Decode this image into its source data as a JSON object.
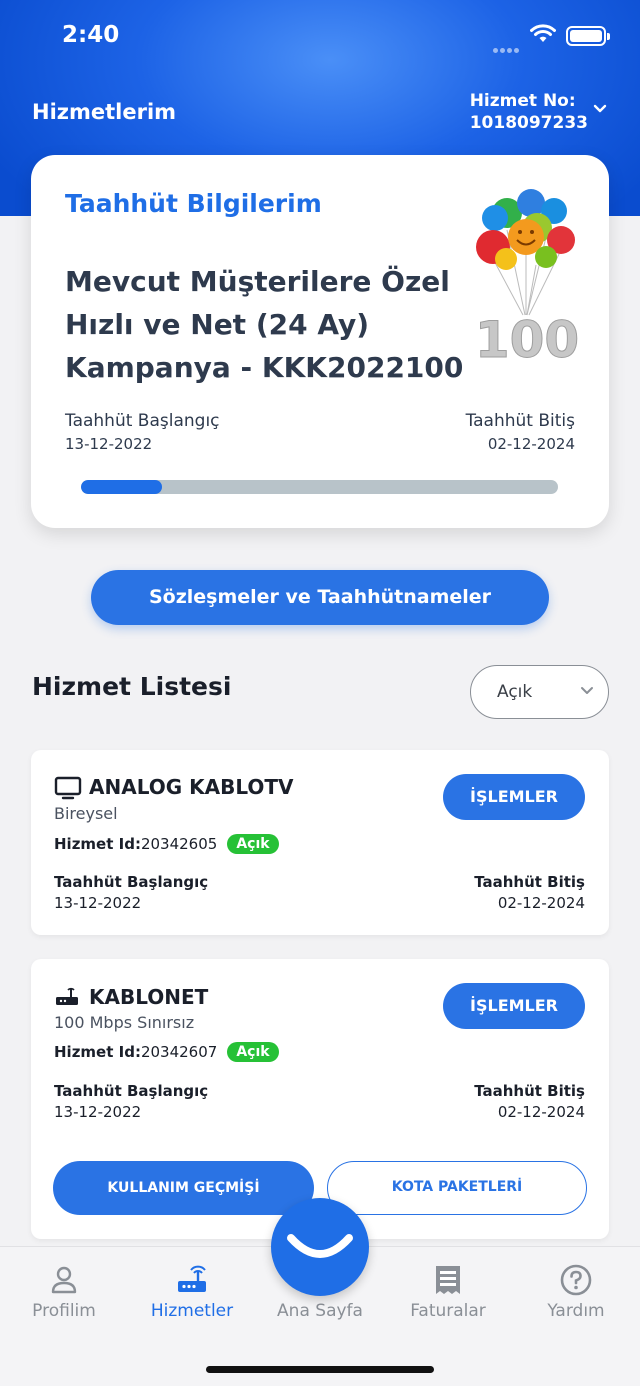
{
  "status_bar": {
    "time": "2:40"
  },
  "header": {
    "title": "Hizmetlerim",
    "service_no_label": "Hizmet No:",
    "service_no_value": "1018097233"
  },
  "commitment_card": {
    "title": "Taahhüt Bilgilerim",
    "campaign_name": "Mevcut Müşterilere Özel Hızlı ve Net (24 Ay) Kampanya - KKK2022100",
    "start_label": "Taahhüt Başlangıç",
    "start_date": "13-12-2022",
    "end_label": "Taahhüt Bitiş",
    "end_date": "02-12-2024",
    "progress_fraction": 0.17,
    "badge_number": "100"
  },
  "contracts_button_label": "Sözleşmeler ve Taahhütnameler",
  "service_list": {
    "title": "Hizmet Listesi",
    "filter_selected": "Açık",
    "items": [
      {
        "icon": "tv-icon",
        "name": "ANALOG KABLOTV",
        "subtitle": "Bireysel",
        "id_label": "Hizmet Id:",
        "id_value": "20342605",
        "status": "Açık",
        "start_label": "Taahhüt Başlangıç",
        "start_date": "13-12-2022",
        "end_label": "Taahhüt Bitiş",
        "end_date": "02-12-2024",
        "actions_label": "İŞLEMLER"
      },
      {
        "icon": "router-icon",
        "name": "KABLONET",
        "subtitle": "100 Mbps Sınırsız",
        "id_label": "Hizmet Id:",
        "id_value": "20342607",
        "status": "Açık",
        "start_label": "Taahhüt Başlangıç",
        "start_date": "13-12-2022",
        "end_label": "Taahhüt Bitiş",
        "end_date": "02-12-2024",
        "actions_label": "İŞLEMLER",
        "usage_history_label": "KULLANIM GEÇMİŞİ",
        "quota_packages_label": "KOTA PAKETLERİ"
      }
    ]
  },
  "tabbar": {
    "items": [
      {
        "label": "Profilim",
        "icon": "person-icon"
      },
      {
        "label": "Hizmetler",
        "icon": "router-icon",
        "active": true
      },
      {
        "label": "Ana Sayfa",
        "icon": "smile-icon"
      },
      {
        "label": "Faturalar",
        "icon": "receipt-icon"
      },
      {
        "label": "Yardım",
        "icon": "help-icon"
      }
    ]
  },
  "colors": {
    "primary": "#1f6ee6",
    "status_green": "#26c136",
    "header_blue": "#0a4ccf"
  }
}
